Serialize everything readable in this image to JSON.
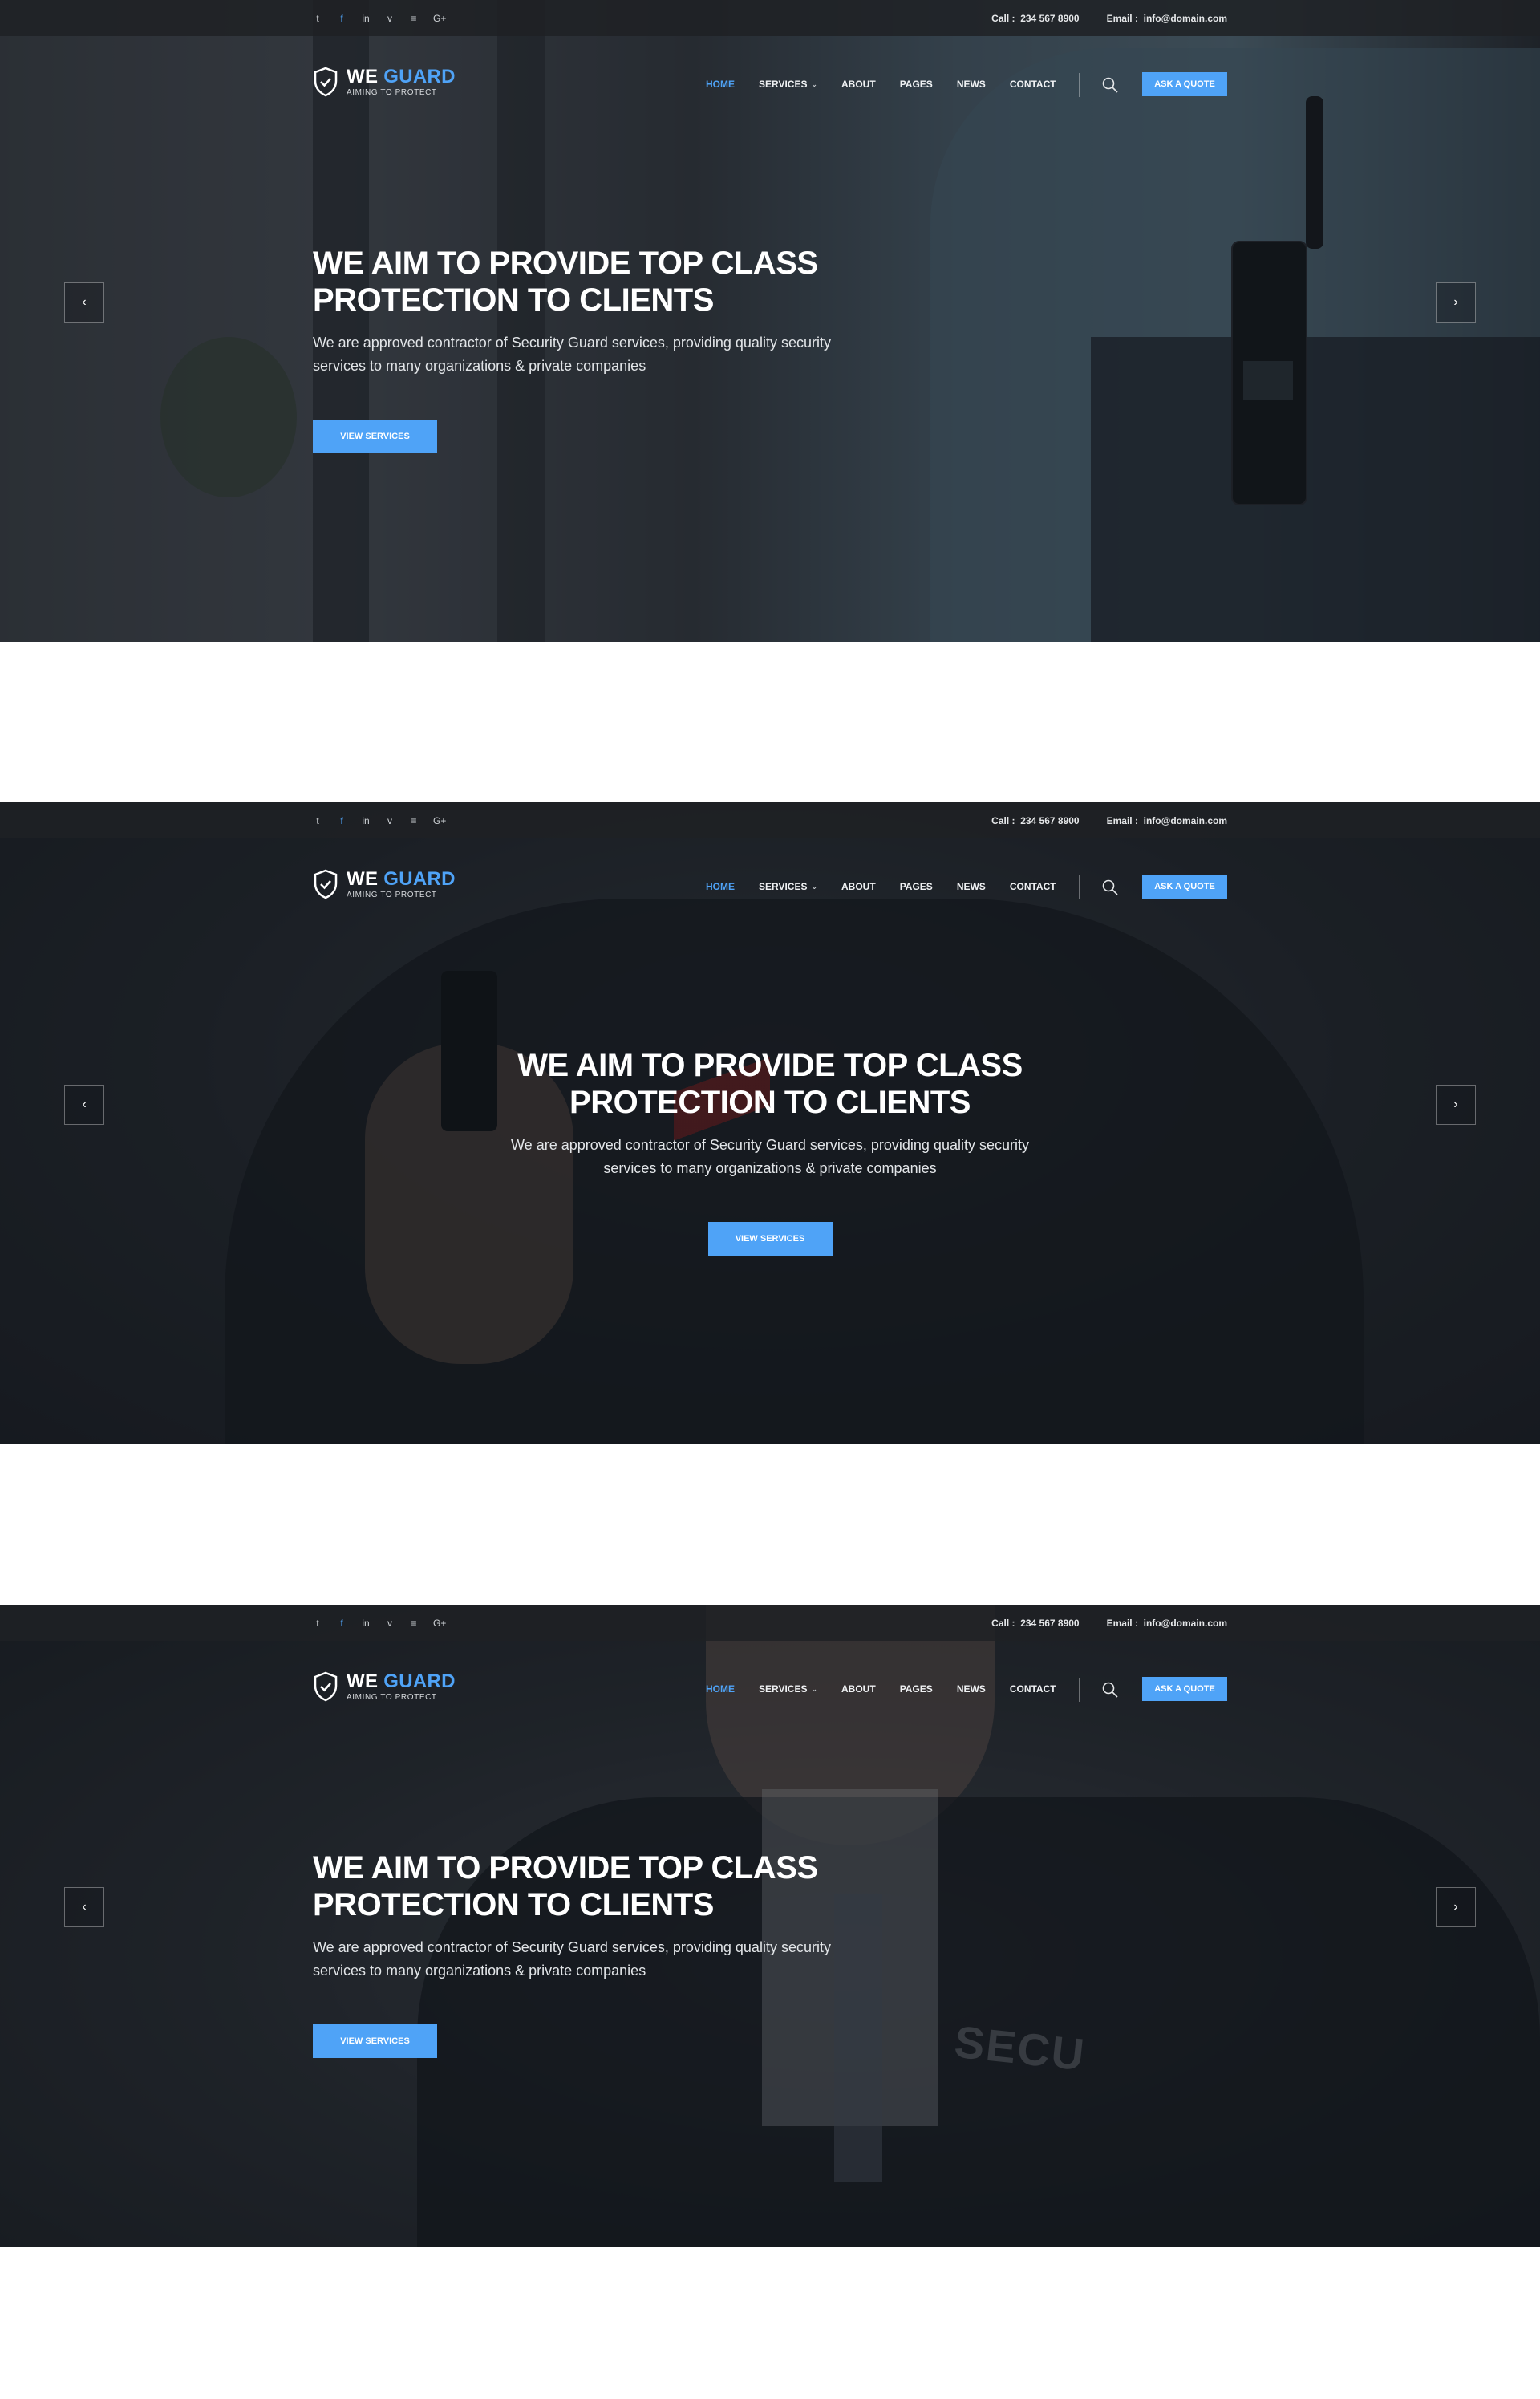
{
  "topbar": {
    "social_icons": [
      "twitter-icon",
      "facebook-icon",
      "linkedin-icon",
      "vimeo-icon",
      "rss-icon",
      "google-plus-icon"
    ],
    "social_glyphs": [
      "t",
      "f",
      "in",
      "v",
      "≡",
      "G+"
    ],
    "call_label": "Call :",
    "call_number": "234 567 8900",
    "email_label": "Email :",
    "email_value": "info@domain.com"
  },
  "header": {
    "logo_word1": "WE",
    "logo_word2": "GUARD",
    "logo_tagline": "AIMING TO PROTECT",
    "nav": [
      {
        "label": "HOME",
        "active": true
      },
      {
        "label": "SERVICES",
        "dropdown": true
      },
      {
        "label": "ABOUT"
      },
      {
        "label": "PAGES"
      },
      {
        "label": "NEWS"
      },
      {
        "label": "CONTACT"
      }
    ],
    "quote_button": "ASK A QUOTE"
  },
  "slides": [
    {
      "title_line1": "WE AIM TO PROVIDE TOP CLASS",
      "title_line2": "PROTECTION TO CLIENTS",
      "subtitle_line1": "We are approved contractor of Security Guard services, providing quality security",
      "subtitle_line2": "services to many organizations & private companies",
      "cta": "VIEW SERVICES",
      "align": "left"
    },
    {
      "title_line1": "WE AIM TO PROVIDE TOP CLASS",
      "title_line2": "PROTECTION TO CLIENTS",
      "subtitle_line1": "We are approved contractor of Security Guard services, providing quality security",
      "subtitle_line2": "services to many organizations & private companies",
      "cta": "VIEW SERVICES",
      "align": "center"
    },
    {
      "title_line1": "WE AIM TO PROVIDE TOP CLASS",
      "title_line2": "PROTECTION TO CLIENTS",
      "subtitle_line1": "We are approved contractor of Security Guard services, providing quality security",
      "subtitle_line2": "services to many organizations & private companies",
      "cta": "VIEW SERVICES",
      "align": "left"
    }
  ],
  "arrows": {
    "prev": "‹",
    "next": "›"
  },
  "colors": {
    "accent": "#4fa3f7",
    "topbar": "#1e2125"
  }
}
